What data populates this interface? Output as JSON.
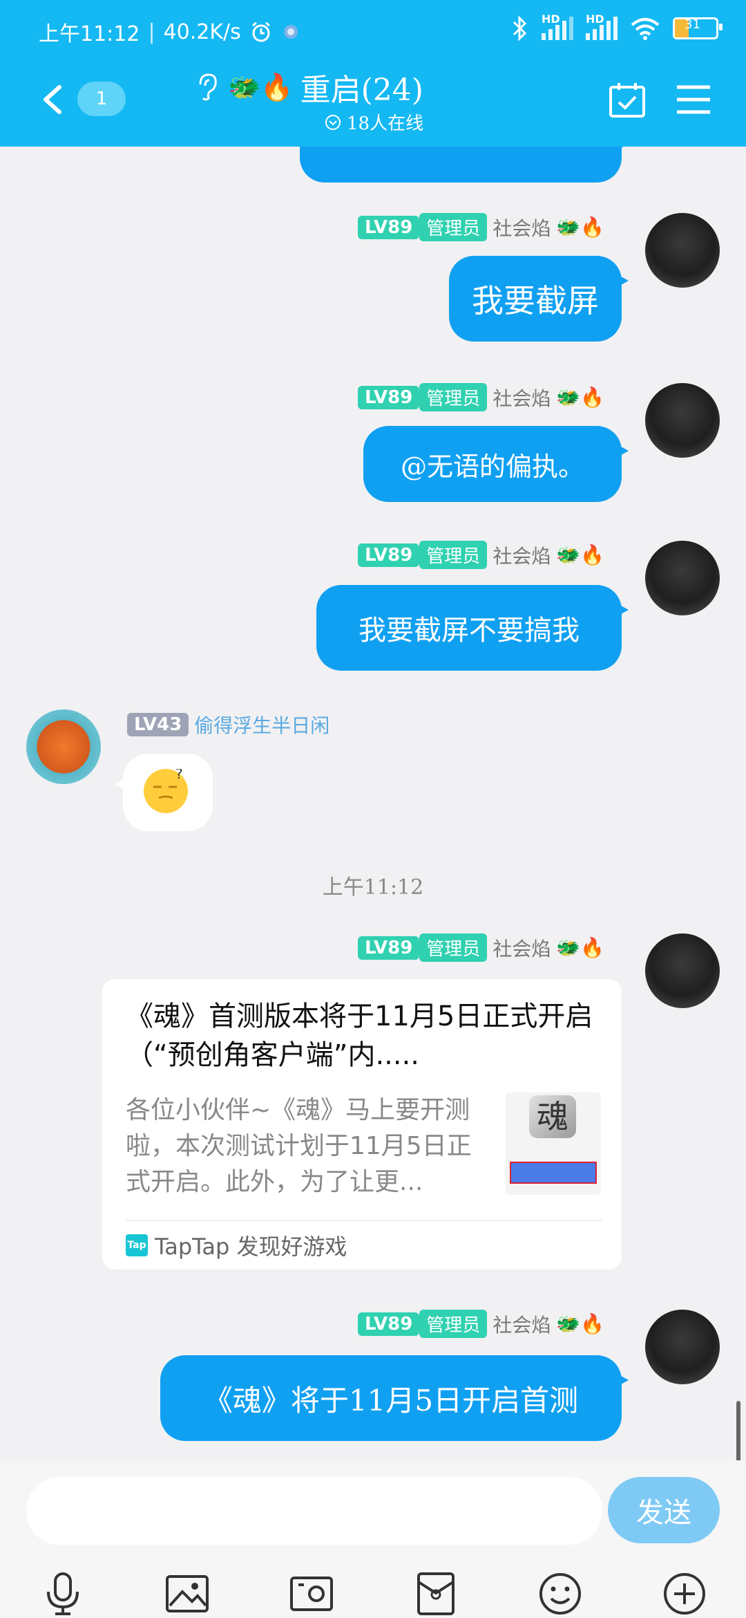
{
  "status": {
    "time": "上午11:12",
    "speed": "40.2K/s",
    "hd1": "HD",
    "hd2": "HD",
    "battery": "31"
  },
  "header": {
    "unread_count": "1",
    "title": "重启(24)",
    "title_emoji": "🐲🔥",
    "online": "18人在线"
  },
  "messages": {
    "m1": {
      "lv": "LV89",
      "role": "管理员",
      "nick": "社会焰",
      "text": "我要截屏"
    },
    "m2": {
      "lv": "LV89",
      "role": "管理员",
      "nick": "社会焰",
      "text": "@无语的偏执。"
    },
    "m3": {
      "lv": "LV89",
      "role": "管理员",
      "nick": "社会焰",
      "text": "我要截屏不要搞我"
    },
    "m4": {
      "lv": "LV43",
      "nick": "偷得浮生半日闲"
    },
    "time_sep": "上午11:12",
    "m5": {
      "lv": "LV89",
      "role": "管理员",
      "nick": "社会焰",
      "card_title": "《魂》首测版本将于11月5日正式开启（“预创角客户端”内.....",
      "card_desc": "各位小伙伴~《魂》马上要开测啦，本次测试计划于11月5日正式开启。此外，为了让更...",
      "card_thumb_char": "魂",
      "card_source": "TapTap 发现好游戏",
      "tap_icon_text": "Tap"
    },
    "m6": {
      "lv": "LV89",
      "role": "管理员",
      "nick": "社会焰",
      "text": "《魂》将于11月5日开启首测"
    }
  },
  "composer": {
    "placeholder": "",
    "send_label": "发送"
  }
}
